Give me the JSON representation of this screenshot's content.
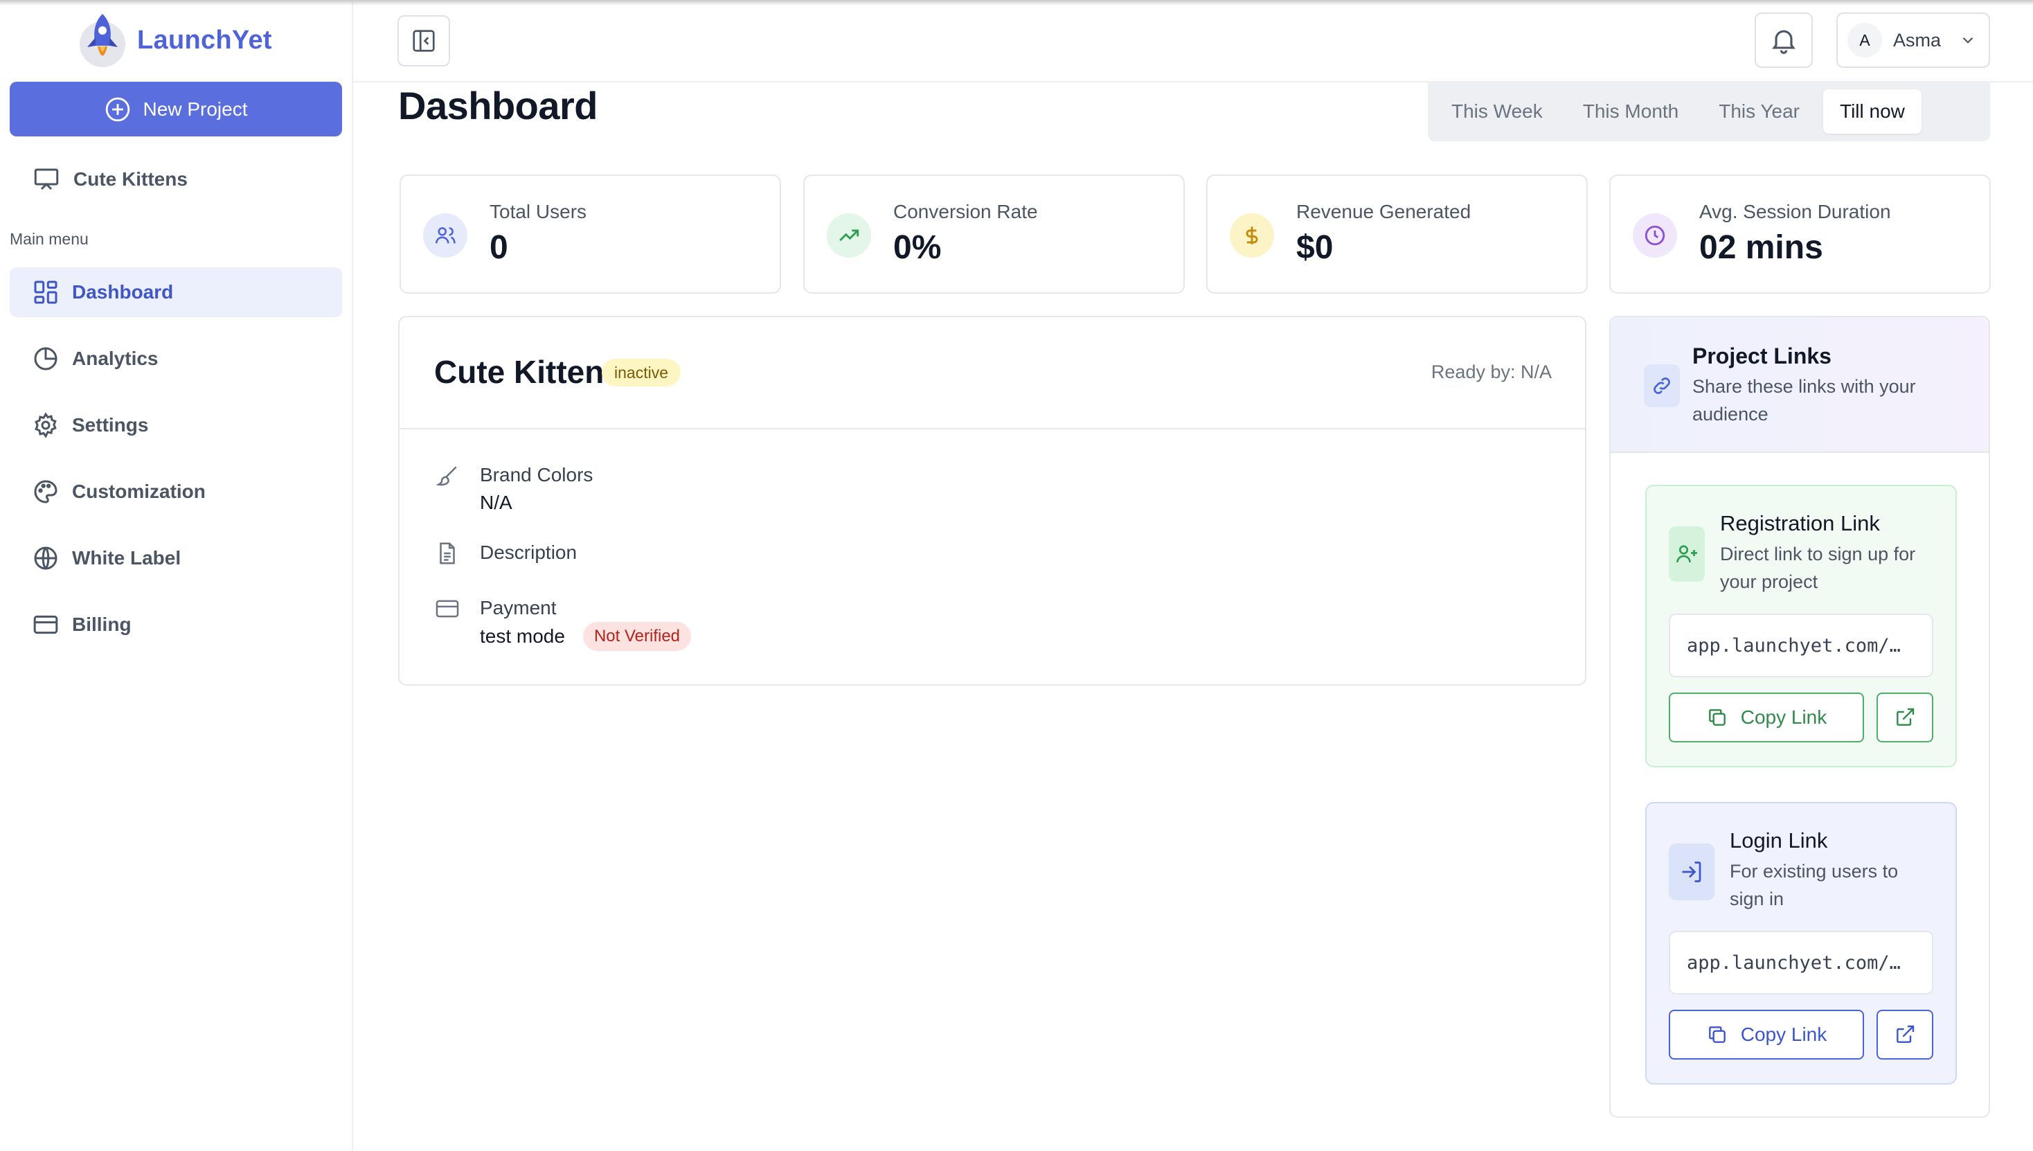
{
  "app": {
    "name": "LaunchYet"
  },
  "sidebar": {
    "new_project_label": "New Project",
    "current_project": "Cute Kittens",
    "menu_caption": "Main menu",
    "items": [
      {
        "label": "Dashboard",
        "icon": "dashboard-icon",
        "active": true
      },
      {
        "label": "Analytics",
        "icon": "pie-chart-icon",
        "active": false
      },
      {
        "label": "Settings",
        "icon": "gear-icon",
        "active": false
      },
      {
        "label": "Customization",
        "icon": "palette-icon",
        "active": false
      },
      {
        "label": "White Label",
        "icon": "globe-icon",
        "active": false
      },
      {
        "label": "Billing",
        "icon": "credit-card-icon",
        "active": false
      }
    ]
  },
  "header": {
    "user_initial": "A",
    "user_name": "Asma"
  },
  "page": {
    "title": "Dashboard",
    "periods": [
      {
        "label": "This Week",
        "active": false
      },
      {
        "label": "This Month",
        "active": false
      },
      {
        "label": "This Year",
        "active": false
      },
      {
        "label": "Till now",
        "active": true
      }
    ]
  },
  "stats": [
    {
      "label": "Total Users",
      "value": "0",
      "icon": "users-icon",
      "color": "#4f63d9",
      "bg": "#e6ebfb"
    },
    {
      "label": "Conversion Rate",
      "value": "0%",
      "icon": "trending-up-icon",
      "color": "#2f9e52",
      "bg": "#e3f6e8"
    },
    {
      "label": "Revenue Generated",
      "value": "$0",
      "icon": "dollar-icon",
      "color": "#c28a06",
      "bg": "#fcf3c7"
    },
    {
      "label": "Avg. Session Duration",
      "value": "02 mins",
      "icon": "clock-icon",
      "color": "#8b4fd6",
      "bg": "#f1e7fb"
    }
  ],
  "project": {
    "name": "Cute Kittens",
    "status": "inactive",
    "ready_by": "Ready by: N/A",
    "brand_colors_label": "Brand Colors",
    "brand_colors_value": "N/A",
    "description_label": "Description",
    "payment_label": "Payment",
    "payment_mode": "test mode",
    "payment_status": "Not Verified"
  },
  "links": {
    "title": "Project Links",
    "subtitle": "Share these links with your audience",
    "registration": {
      "title": "Registration Link",
      "subtitle": "Direct link to sign up for your project",
      "url": "app.launchyet.com/…",
      "copy_label": "Copy Link"
    },
    "login": {
      "title": "Login Link",
      "subtitle": "For existing users to sign in",
      "url": "app.launchyet.com/…",
      "copy_label": "Copy Link"
    }
  },
  "colors": {
    "accent": "#5a6fdd",
    "green": "#2f8a4a",
    "blue": "#3b55cc"
  }
}
